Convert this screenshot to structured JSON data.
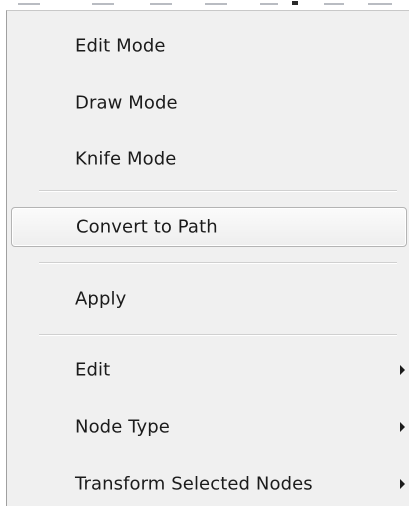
{
  "menu": {
    "items": [
      {
        "label": "Edit Mode"
      },
      {
        "label": "Draw Mode"
      },
      {
        "label": "Knife Mode"
      },
      {
        "label": "Convert to Path"
      },
      {
        "label": "Apply"
      },
      {
        "label": "Edit"
      },
      {
        "label": "Node Type"
      },
      {
        "label": "Transform Selected Nodes"
      }
    ]
  }
}
